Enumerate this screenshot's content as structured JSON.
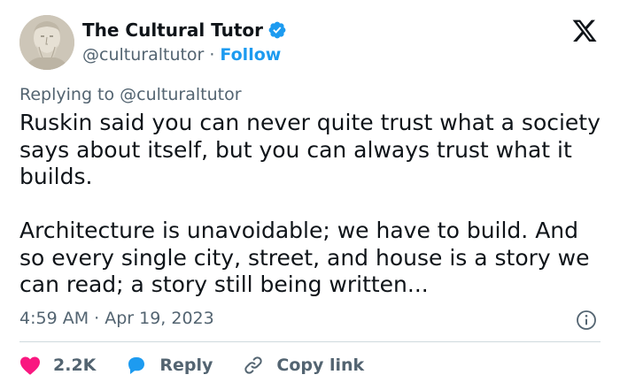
{
  "author": {
    "name": "The Cultural Tutor",
    "handle": "@culturaltutor",
    "separator": "·",
    "follow_label": "Follow"
  },
  "replying": {
    "prefix": "Replying to ",
    "mention": "@culturaltutor"
  },
  "tweet": {
    "paragraph1": "Ruskin said you can never quite trust what a society says about itself, but you can always trust what it builds.",
    "paragraph2": "Architecture is unavoidable; we have to build. And so every single city, street, and house is a story we can read; a story still being written..."
  },
  "timestamp": "4:59 AM · Apr 19, 2023",
  "actions": {
    "like_count": "2.2K",
    "reply_label": "Reply",
    "copy_label": "Copy link"
  },
  "colors": {
    "accent": "#1d9bf0",
    "like": "#f91880",
    "text": "#0f1419",
    "secondary": "#536471"
  }
}
